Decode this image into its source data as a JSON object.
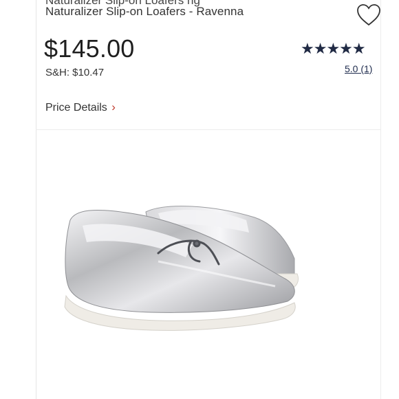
{
  "product": {
    "cut_title": "Naturalizer Slip-on Loafers ng",
    "title": "Naturalizer Slip-on Loafers - Ravenna",
    "price": "$145.00",
    "shipping": "S&H: $10.47",
    "price_details_label": "Price Details",
    "price_details_chevron": "›"
  },
  "rating": {
    "stars": "★★★★★",
    "text": "5.0 (1)"
  },
  "icons": {
    "favorite": "heart-outline-icon"
  },
  "colors": {
    "star": "#202a44",
    "link": "#1e2b4d",
    "chevron": "#c0392b",
    "shoe_metal": "#c9c9cb",
    "sole": "#efece6"
  }
}
